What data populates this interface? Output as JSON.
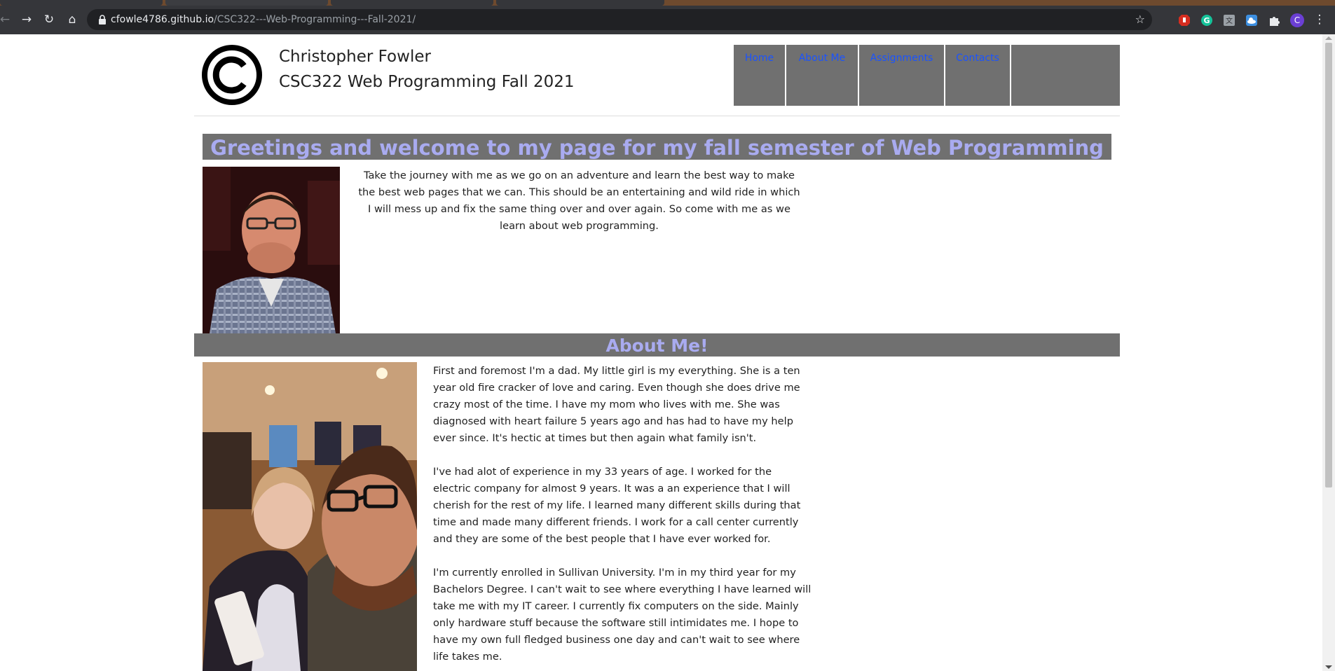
{
  "browser": {
    "url_host": "cfowle4786.github.io",
    "url_path": "/CSC322---Web-Programming---Fall-2021/",
    "nav_icons": [
      "back-arrow-icon",
      "forward-arrow-icon",
      "reload-icon",
      "home-icon"
    ],
    "extension_icons": [
      "adblock-icon",
      "grammarly-icon",
      "translate-icon",
      "cloud-icon",
      "puzzle-extensions-icon"
    ],
    "profile_initial": "C",
    "colors": {
      "toolbar": "#35363a",
      "omnibox": "#202124",
      "tabstrip": "#6e4a2e"
    }
  },
  "header": {
    "logo": "copyright-symbol-logo",
    "name": "Christopher Fowler",
    "course": "CSC322 Web Programming Fall 2021"
  },
  "nav": {
    "items": [
      "Home",
      "About Me",
      "Assignments",
      "Contacts"
    ],
    "colors": {
      "background": "#707070",
      "link": "#1a53ff"
    }
  },
  "greeting": {
    "title": "Greetings and welcome to my page for my fall semester of Web Programming",
    "intro": "Take the journey with me as we go on an adventure and learn the best way to make the best web pages that we can. This should be an entertaining and wild ride in which I will mess up and fix the same thing over and over again. So come with me as we learn about web programming."
  },
  "about": {
    "title": "About Me!",
    "paragraphs": [
      "First and foremost I'm a dad. My little girl is my everything. She is a ten year old fire cracker of love and caring. Even though she does drive me crazy most of the time. I have my mom who lives with me. She was diagnosed with heart failure 5 years ago and has had to have my help ever since. It's hectic at times but then again what family isn't.",
      "I've had alot of experience in my 33 years of age. I worked for the electric company for almost 9 years. It was a an experience that I will cherish for the rest of my life. I learned many different skills during that time and made many different friends. I work for a call center currently and they are some of the best people that I have ever worked for.",
      "I'm currently enrolled in Sullivan University. I'm in my third year for my Bachelors Degree. I can't wait to see where everything I have learned will take me with my IT career. I currently fix computers on the side. Mainly only hardware stuff because the software still intimidates me. I hope to have my own full fledged business one day and can't wait to see where life takes me."
    ]
  },
  "theme": {
    "section_bar": "#707070",
    "heading": "#a9abf0"
  }
}
